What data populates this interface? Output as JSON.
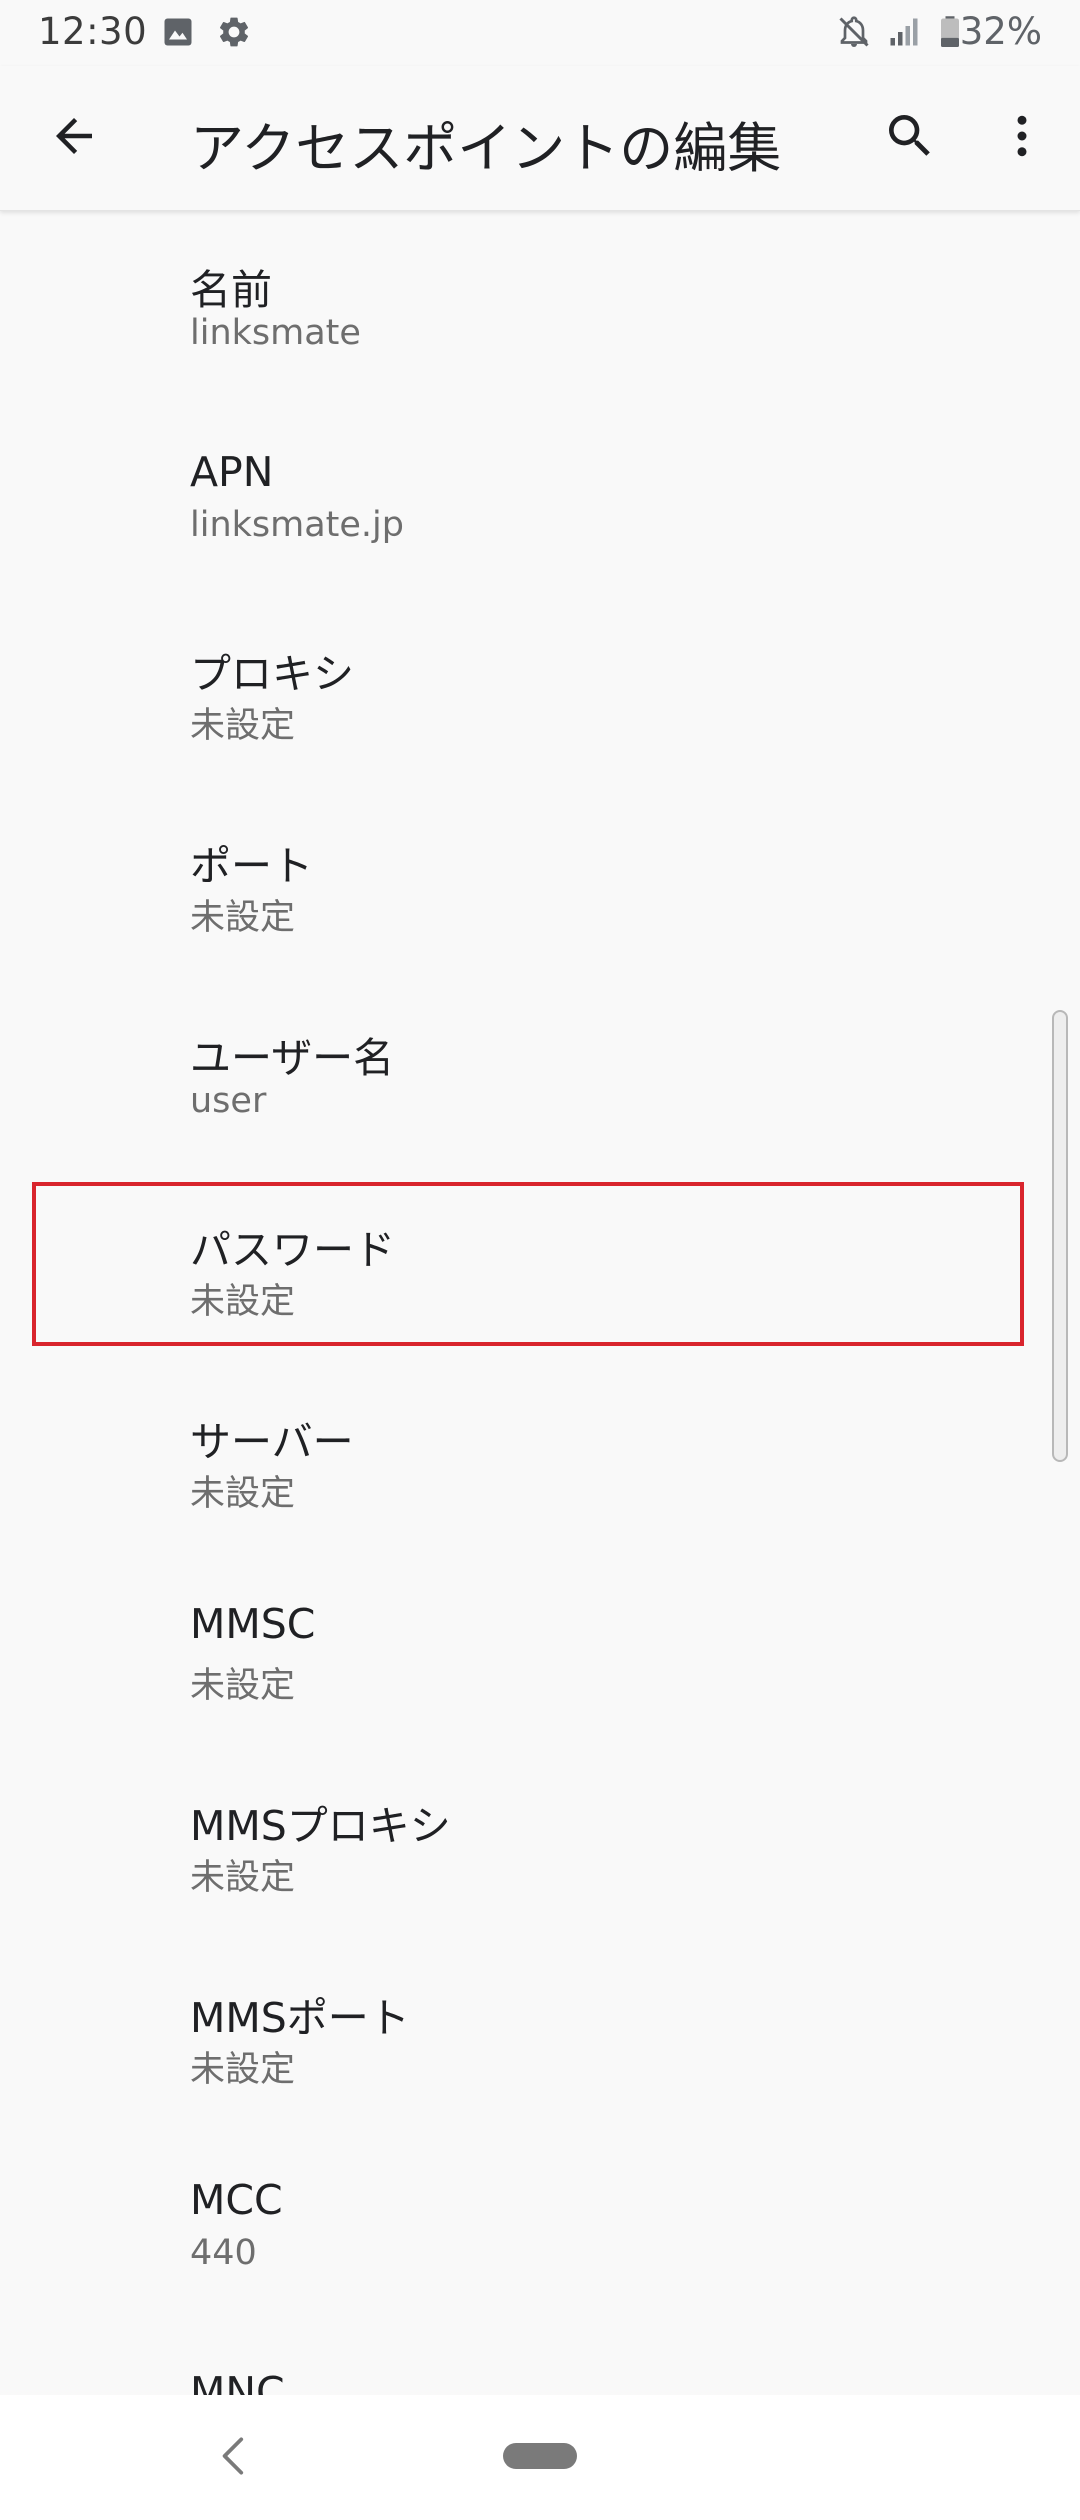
{
  "status_bar": {
    "time": "12:30",
    "left_icons": [
      "image-icon",
      "gear-icon"
    ],
    "right_icons": [
      "notifications-off-icon",
      "signal-icon",
      "battery-icon"
    ],
    "battery_percent_text": "32%",
    "battery_level": 0.32
  },
  "toolbar": {
    "title": "アクセスポイントの編集",
    "back_icon": "arrow-back-icon",
    "search_icon": "search-icon",
    "more_icon": "more-vert-icon"
  },
  "apn_settings": [
    {
      "key": "name",
      "title": "名前",
      "summary": "linksmate"
    },
    {
      "key": "apn",
      "title": "APN",
      "summary": "linksmate.jp"
    },
    {
      "key": "proxy",
      "title": "プロキシ",
      "summary": "未設定"
    },
    {
      "key": "port",
      "title": "ポート",
      "summary": "未設定"
    },
    {
      "key": "username",
      "title": "ユーザー名",
      "summary": "user"
    },
    {
      "key": "password",
      "title": "パスワード",
      "summary": "未設定"
    },
    {
      "key": "server",
      "title": "サーバー",
      "summary": "未設定"
    },
    {
      "key": "mmsc",
      "title": "MMSC",
      "summary": "未設定"
    },
    {
      "key": "mms_proxy",
      "title": "MMSプロキシ",
      "summary": "未設定"
    },
    {
      "key": "mms_port",
      "title": "MMSポート",
      "summary": "未設定"
    },
    {
      "key": "mcc",
      "title": "MCC",
      "summary": "440"
    },
    {
      "key": "mnc",
      "title": "MNC",
      "summary": ""
    }
  ],
  "highlight": {
    "target": "password",
    "color": "#d9252d"
  },
  "nav_bar": {
    "back_icon": "nav-back-icon",
    "home_icon": "home-pill-icon"
  },
  "colors": {
    "background": "#f9f9f9",
    "title_text": "#202124",
    "summary_text": "#6e6e6e"
  }
}
